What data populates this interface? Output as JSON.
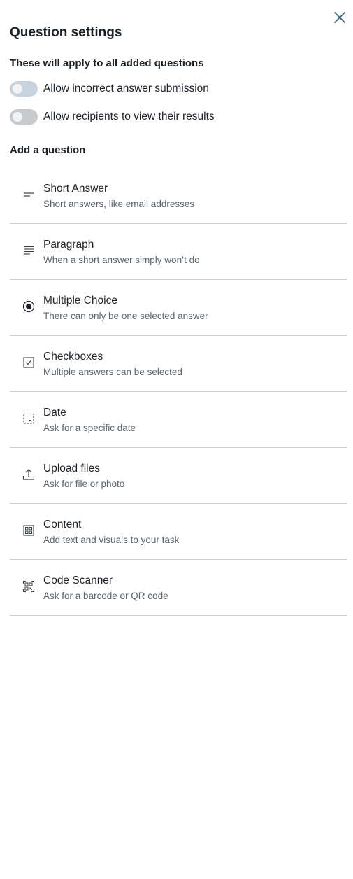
{
  "panel": {
    "title": "Question settings",
    "close_icon": "close-icon"
  },
  "settings": {
    "heading": "These will apply to all added questions",
    "toggles": [
      {
        "label": "Allow incorrect answer submission",
        "enabled": false,
        "color": "#c6d2dc"
      },
      {
        "label": "Allow recipients to view their results",
        "enabled": false,
        "color": "#c7c9cb"
      }
    ]
  },
  "add_question": {
    "heading": "Add a question",
    "items": [
      {
        "title": "Short Answer",
        "description": "Short answers, like email addresses",
        "icon": "short-answer-icon"
      },
      {
        "title": "Paragraph",
        "description": "When a short answer simply won’t do",
        "icon": "paragraph-icon"
      },
      {
        "title": "Multiple Choice",
        "description": "There can only be one selected answer",
        "icon": "radio-button-icon"
      },
      {
        "title": "Checkboxes",
        "description": "Multiple answers can be selected",
        "icon": "checkbox-icon"
      },
      {
        "title": "Date",
        "description": "Ask for a specific date",
        "icon": "calendar-icon"
      },
      {
        "title": "Upload files",
        "description": "Ask for file or photo",
        "icon": "upload-icon"
      },
      {
        "title": "Content",
        "description": "Add text and visuals to your task",
        "icon": "content-grid-icon"
      },
      {
        "title": "Code Scanner",
        "description": "Ask for a barcode or QR code",
        "icon": "qr-code-icon"
      }
    ]
  },
  "colors": {
    "text": "#1d2228",
    "muted_text": "#5a636c",
    "divider": "#c9ced3",
    "close_icon": "#2b5b7a"
  }
}
